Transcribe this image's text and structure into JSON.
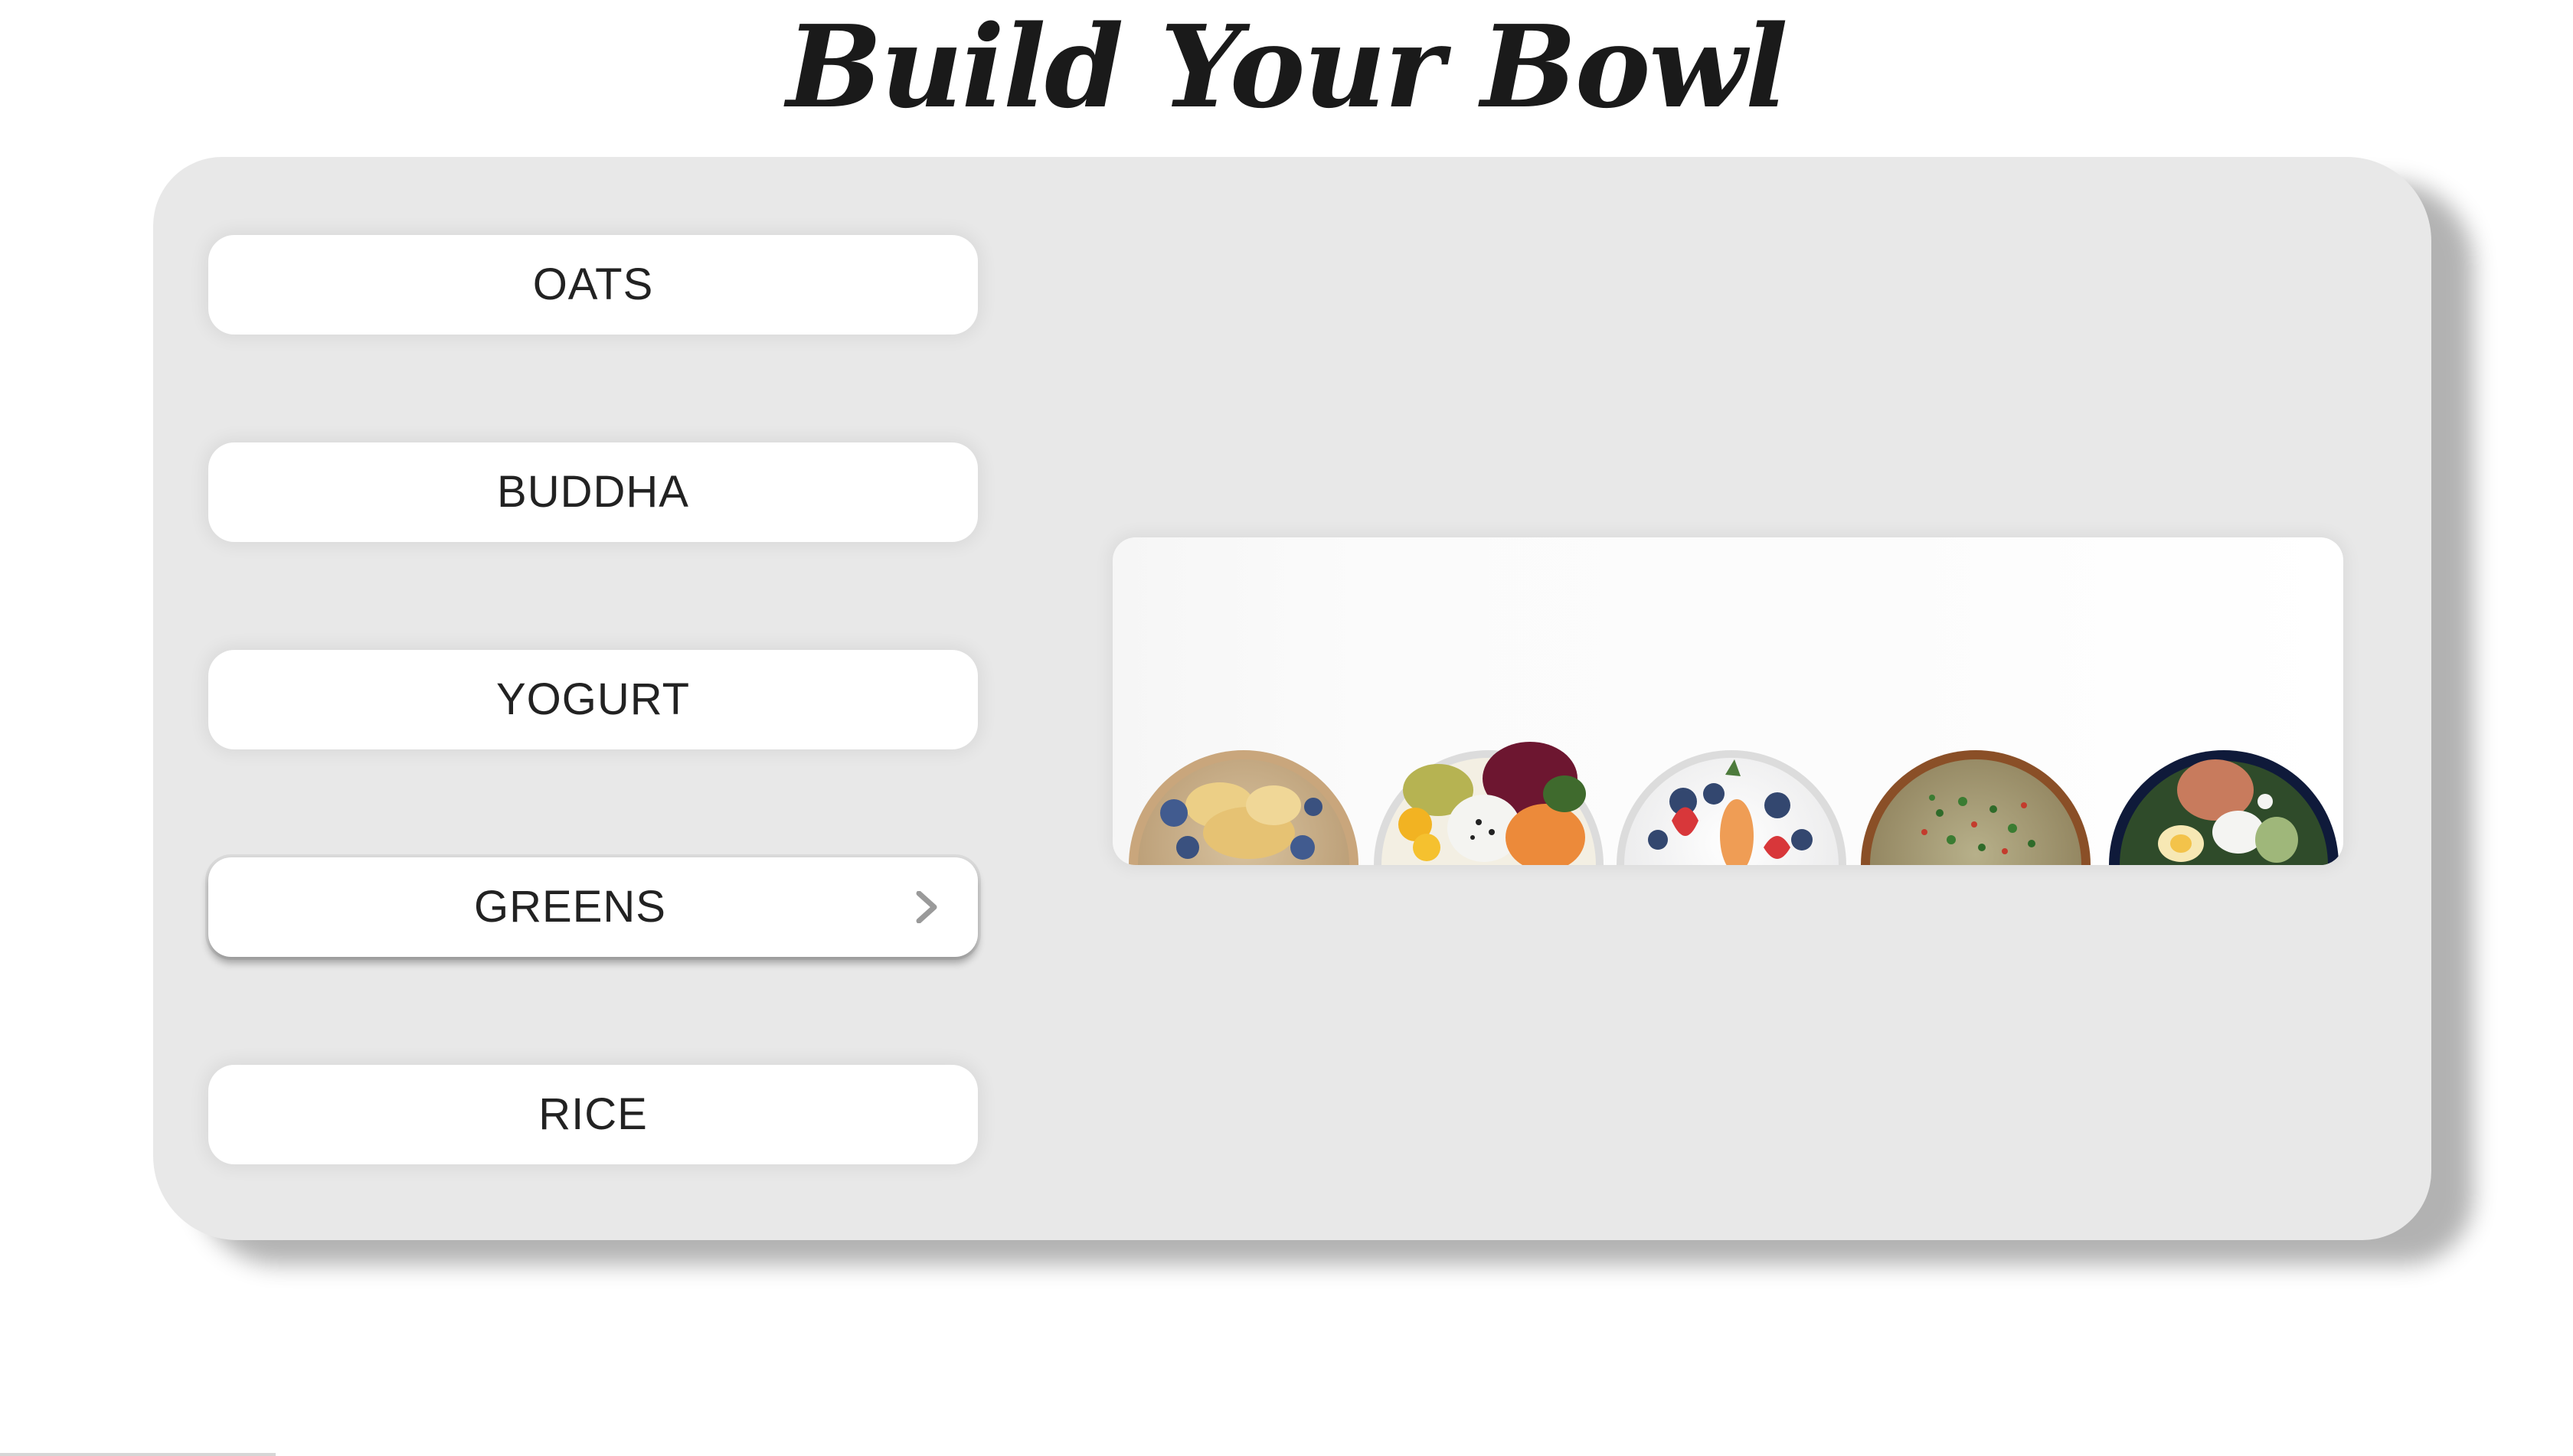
{
  "page": {
    "title": "Build Your Bowl"
  },
  "menu": {
    "items": [
      {
        "label": "OATS",
        "active": false
      },
      {
        "label": "BUDDHA",
        "active": false
      },
      {
        "label": "YOGURT",
        "active": false
      },
      {
        "label": "GREENS",
        "active": true
      },
      {
        "label": "RICE",
        "active": false
      }
    ],
    "active_indicator_icon": "chevron-right-icon"
  },
  "preview": {
    "images": [
      "oats-bowl",
      "buddha-bowl",
      "yogurt-bowl",
      "greens-bowl",
      "rice-bowl"
    ]
  },
  "colors": {
    "card_background": "#e8e8e8",
    "button_background": "#ffffff",
    "text": "#222222",
    "chevron": "#9a9a9a"
  }
}
